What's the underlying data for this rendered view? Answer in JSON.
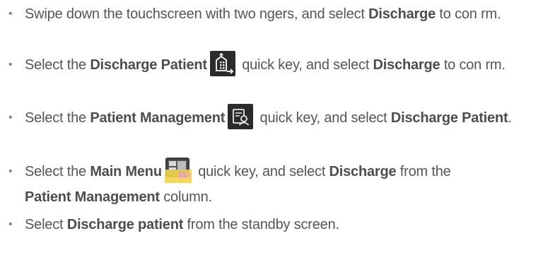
{
  "bullet_char": "•",
  "items": [
    {
      "t1": "Swipe down the touchscreen with two   ngers, and select ",
      "b1": "Discharge",
      "t2": " to con  rm."
    },
    {
      "t1": "Select the ",
      "b1": "Discharge Patient",
      "t2": " quick key, and select ",
      "b2": "Discharge",
      "t3": " to con  rm."
    },
    {
      "t1": "Select the ",
      "b1": "Patient Management",
      "t2": " quick key, and select ",
      "b2": "Discharge Patient",
      "t3": "."
    },
    {
      "t1": "Select the ",
      "b1": "Main Menu",
      "t2": " quick key, and select ",
      "b2": "Discharge",
      "t3": " from the ",
      "b3": "Patient Management",
      "t4": " column."
    },
    {
      "t1": "Select ",
      "b1": "Discharge patient",
      "t2": " from the standby screen."
    }
  ],
  "icons": {
    "discharge_patient": "discharge-patient-quick-key-icon",
    "patient_management": "patient-management-quick-key-icon",
    "main_menu": "main-menu-quick-key-icon"
  },
  "colors": {
    "text": "#555555",
    "bold_text": "#4d4d4d",
    "icon_dark": "#2b2b2b",
    "menu_highlight": "#f3d64a"
  }
}
